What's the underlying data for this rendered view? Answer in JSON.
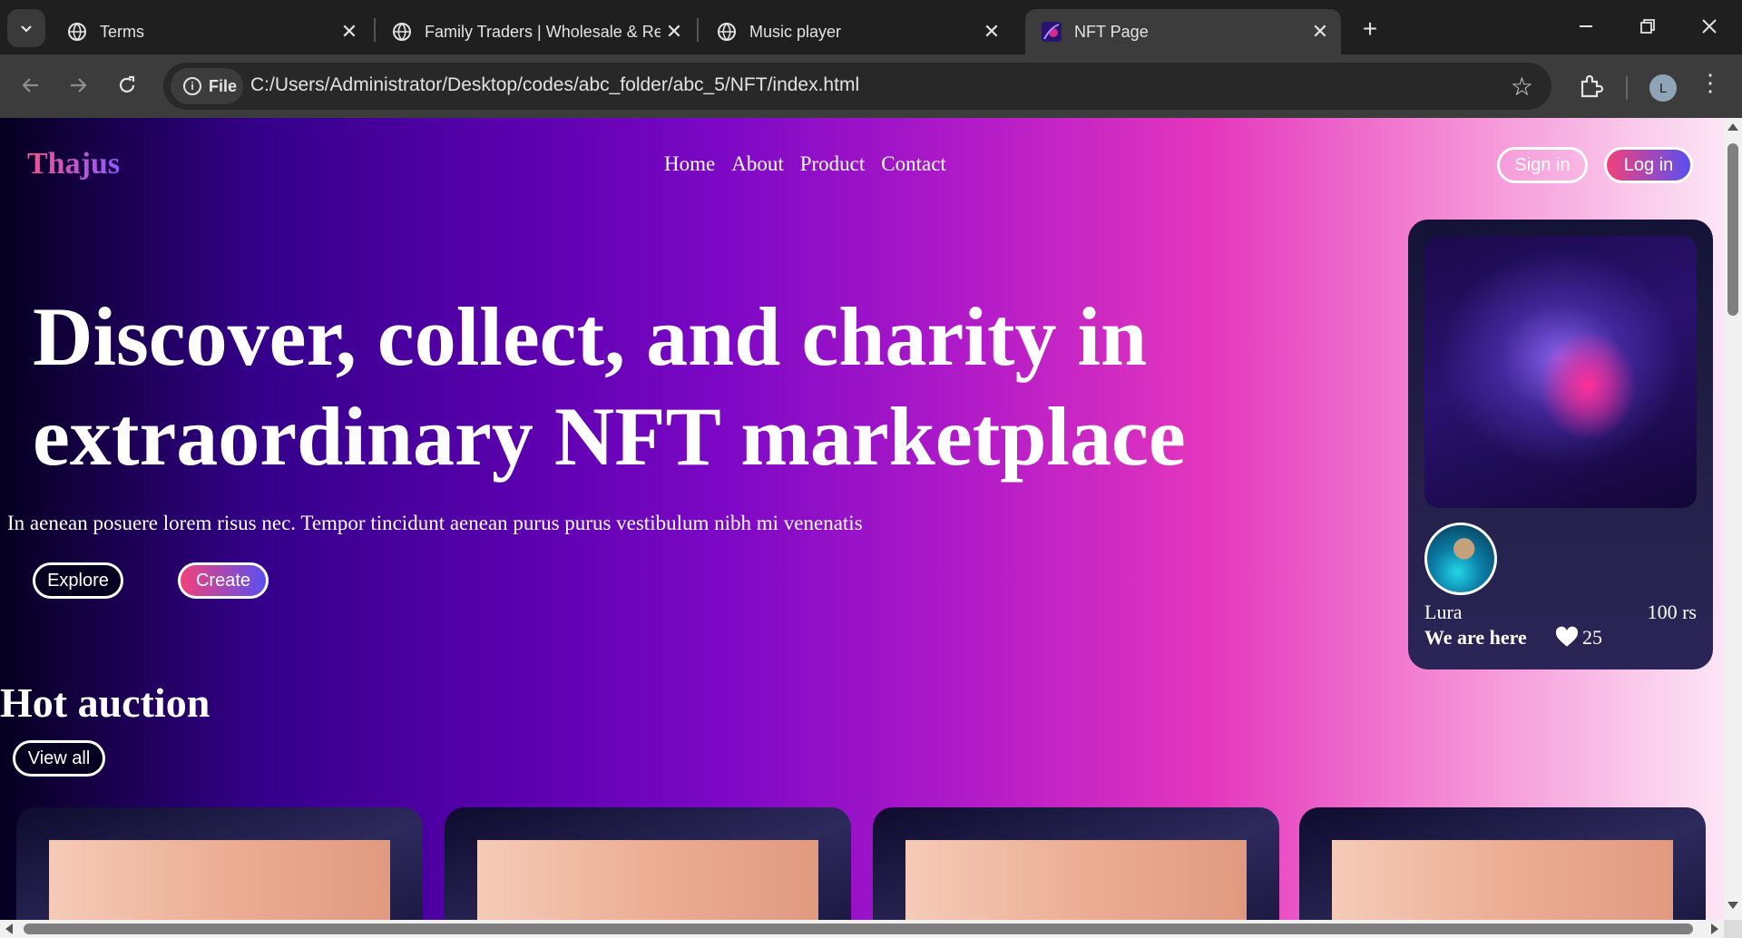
{
  "browser": {
    "tabs": [
      {
        "title": "Terms",
        "favicon": "globe-icon",
        "active": false
      },
      {
        "title": "Family Traders | Wholesale & Re",
        "favicon": "globe-icon",
        "active": false
      },
      {
        "title": "Music player",
        "favicon": "globe-icon",
        "active": false
      },
      {
        "title": "NFT Page",
        "favicon": "nft-favicon",
        "active": true
      }
    ],
    "site_chip": "File",
    "url": "C:/Users/Administrator/Desktop/codes/abc_folder/abc_5/NFT/index.html",
    "profile_initial": "L"
  },
  "page": {
    "logo": "Thajus",
    "nav": [
      "Home",
      "About",
      "Product",
      "Contact"
    ],
    "signin_label": "Sign in",
    "login_label": "Log in",
    "hero_title": "Discover, collect, and charity in extraordinary NFT marketplace",
    "hero_subtitle": "In aenean posuere lorem risus nec. Tempor tincidunt aenean purus purus vestibulum nibh mi venenatis",
    "explore_label": "Explore",
    "create_label": "Create",
    "featured": {
      "name": "Lura",
      "price": "100 rs",
      "tagline": "We are here",
      "likes": "25"
    },
    "section_title": "Hot auction",
    "view_all_label": "View all",
    "auction_cards": 4
  },
  "colors": {
    "accent_pink": "#f2417b",
    "accent_blue": "#5a4ff0"
  }
}
